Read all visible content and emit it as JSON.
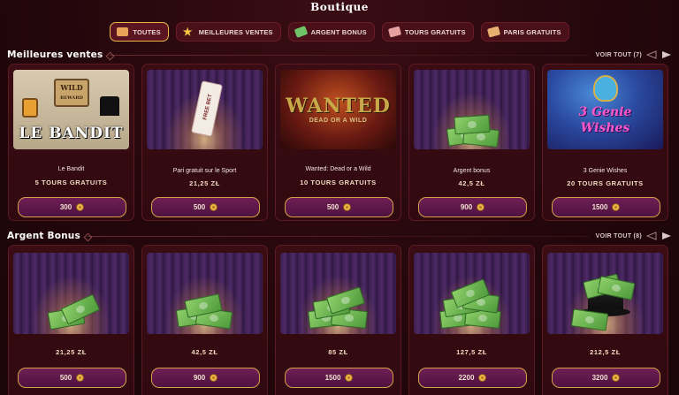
{
  "page": {
    "title": "Boutique"
  },
  "tabs": [
    {
      "label": "TOUTES",
      "icon": "tag-icon",
      "active": true
    },
    {
      "label": "MEILLEURES VENTES",
      "icon": "star-icon",
      "active": false
    },
    {
      "label": "ARGENT BONUS",
      "icon": "money-icon",
      "active": false
    },
    {
      "label": "TOURS GRATUITS",
      "icon": "ticket-icon",
      "active": false
    },
    {
      "label": "PARIS GRATUITS",
      "icon": "bet-ticket-icon",
      "active": false
    }
  ],
  "sections": [
    {
      "title": "Meilleures ventes",
      "see_all": "VOIR TOUT (7)",
      "cards": [
        {
          "name": "Le Bandit",
          "value": "5 TOURS GRATUITS",
          "price": "300",
          "image": "le-bandit-game",
          "image_text": "LE BANDIT",
          "image_badge": "WILD",
          "image_badge2": "REWARD"
        },
        {
          "name": "Pari gratuit sur le Sport",
          "value": "21,25 ZŁ",
          "price": "500",
          "image": "free-bet-ticket",
          "image_text": "FREE BET"
        },
        {
          "name": "Wanted: Dead or a Wild",
          "value": "10 TOURS GRATUITS",
          "price": "500",
          "image": "wanted-game",
          "image_text": "WANTED",
          "image_sub": "DEAD OR A WILD"
        },
        {
          "name": "Argent bonus",
          "value": "42,5 ZŁ",
          "price": "900",
          "image": "money-stack"
        },
        {
          "name": "3 Genie Wishes",
          "value": "20 TOURS GRATUITS",
          "price": "1500",
          "image": "genie-game",
          "image_text": "3 Genie",
          "image_sub": "Wishes"
        }
      ]
    },
    {
      "title": "Argent Bonus",
      "see_all": "VOIR TOUT (8)",
      "cards": [
        {
          "name": "",
          "value": "21,25 ZŁ",
          "price": "500",
          "image": "money-stack"
        },
        {
          "name": "",
          "value": "42,5 ZŁ",
          "price": "900",
          "image": "money-stack"
        },
        {
          "name": "",
          "value": "85 ZŁ",
          "price": "1500",
          "image": "money-stack"
        },
        {
          "name": "",
          "value": "127,5 ZŁ",
          "price": "2200",
          "image": "money-stack"
        },
        {
          "name": "",
          "value": "212,5 ZŁ",
          "price": "3200",
          "image": "money-top-hat"
        }
      ]
    }
  ],
  "colors": {
    "accent": "#f0b64a",
    "background": "#24070c",
    "card": "#3b0c13",
    "button": "#6e1f55"
  }
}
